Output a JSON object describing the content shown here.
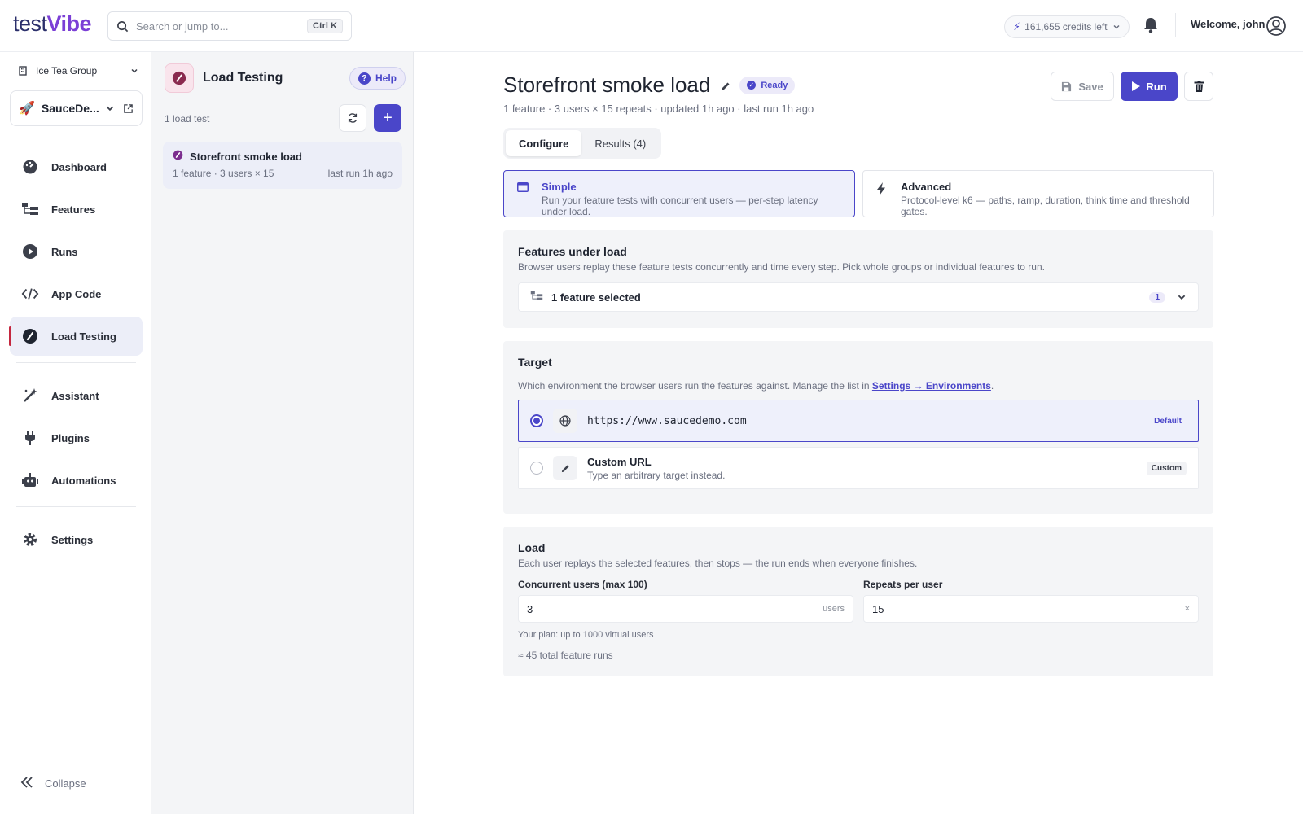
{
  "brand": {
    "logo_text_a": "test",
    "logo_text_b": "Vibe"
  },
  "search": {
    "placeholder": "Search or jump to...",
    "shortcut": "Ctrl K"
  },
  "header": {
    "credits": "161,655 credits left",
    "welcome": "Welcome, john"
  },
  "sidebar": {
    "org": "Ice Tea Group",
    "project": "SauceDe...",
    "items": [
      {
        "label": "Dashboard",
        "icon": "dashboard-icon"
      },
      {
        "label": "Features",
        "icon": "features-icon"
      },
      {
        "label": "Runs",
        "icon": "play-circle-icon"
      },
      {
        "label": "App Code",
        "icon": "code-icon"
      },
      {
        "label": "Load Testing",
        "icon": "gauge-icon",
        "active": true
      }
    ],
    "items2": [
      {
        "label": "Assistant",
        "icon": "magic-wand-icon"
      },
      {
        "label": "Plugins",
        "icon": "plug-icon"
      },
      {
        "label": "Automations",
        "icon": "robot-icon"
      }
    ],
    "settings": "Settings",
    "collapse": "Collapse"
  },
  "list_panel": {
    "title": "Load Testing",
    "help": "Help",
    "count": "1 load test",
    "items": [
      {
        "title": "Storefront smoke load",
        "meta": "1 feature · 3 users × 15",
        "last_run": "last run 1h ago"
      }
    ]
  },
  "main": {
    "title": "Storefront smoke load",
    "status": "Ready",
    "subtitle": "1 feature · 3 users × 15 repeats · updated 1h ago · last run 1h ago",
    "save": "Save",
    "run": "Run",
    "tabs": [
      {
        "label": "Configure",
        "active": true
      },
      {
        "label": "Results (4)"
      }
    ],
    "modes": [
      {
        "title": "Simple",
        "desc": "Run your feature tests with concurrent users — per-step latency under load.",
        "active": true
      },
      {
        "title": "Advanced",
        "desc": "Protocol-level k6 — paths, ramp, duration, think time and threshold gates."
      }
    ],
    "features_section": {
      "title": "Features under load",
      "desc": "Browser users replay these feature tests concurrently and time every step. Pick whole groups or individual features to run.",
      "selected": "1 feature selected",
      "count": "1"
    },
    "target_section": {
      "title": "Target",
      "desc_prefix": "Which environment the browser users run the features against. Manage the list in ",
      "link": "Settings → Environments",
      "desc_suffix": ".",
      "options": [
        {
          "url": "https://www.saucedemo.com",
          "tag": "Default",
          "selected": true
        },
        {
          "title": "Custom URL",
          "desc": "Type an arbitrary target instead.",
          "tag": "Custom"
        }
      ]
    },
    "load_section": {
      "title": "Load",
      "desc": "Each user replays the selected features, then stops — the run ends when everyone finishes.",
      "users_label": "Concurrent users (max 100)",
      "users_value": "3",
      "users_suffix": "users",
      "repeats_label": "Repeats per user",
      "repeats_value": "15",
      "repeats_suffix": "×",
      "plan_hint": "Your plan: up to 1000 virtual users",
      "total": "≈ 45 total feature runs"
    }
  },
  "colors": {
    "accent": "#4a46c9",
    "active_marker": "#c4273f"
  }
}
